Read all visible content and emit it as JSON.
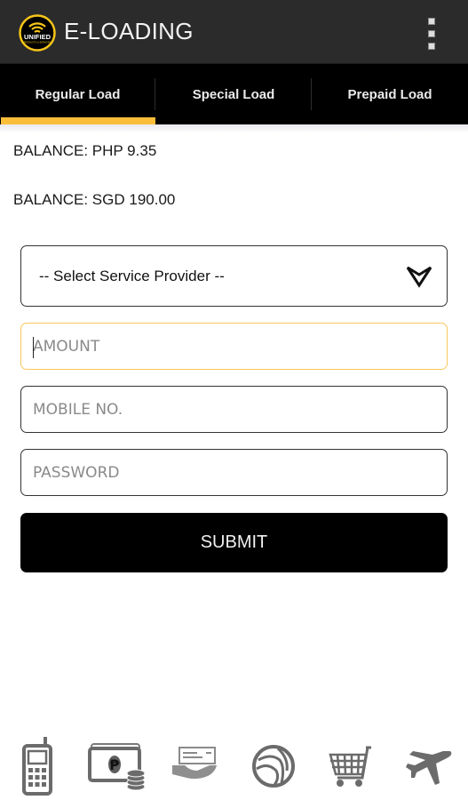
{
  "appbar": {
    "title": "E-LOADING",
    "logo": {
      "name": "unified-logo",
      "text": "UNIFIED",
      "subtext": "PRODUCTS & SERVICES",
      "accent": "#f5c518"
    },
    "menu_icon": "overflow-menu-icon"
  },
  "tabs": [
    {
      "label": "Regular Load",
      "selected": true
    },
    {
      "label": "Special Load",
      "selected": false
    },
    {
      "label": "Prepaid Load",
      "selected": false
    }
  ],
  "balances": [
    "BALANCE: PHP 9.35",
    "BALANCE: SGD 190.00"
  ],
  "form": {
    "service_provider": {
      "selected": "-- Select Service Provider --",
      "icon": "chevron-down-icon"
    },
    "amount": {
      "value": "",
      "placeholder": "AMOUNT",
      "focused": true
    },
    "mobile": {
      "value": "",
      "placeholder": "MOBILE NO."
    },
    "password": {
      "value": "",
      "placeholder": "PASSWORD"
    },
    "submit_label": "SUBMIT"
  },
  "bottom_nav": [
    {
      "name": "mobile-phone-icon"
    },
    {
      "name": "cash-peso-icon"
    },
    {
      "name": "bill-payment-icon"
    },
    {
      "name": "globe-icon"
    },
    {
      "name": "shopping-cart-icon"
    },
    {
      "name": "airplane-icon"
    }
  ],
  "colors": {
    "appbar_bg": "#2b2b2b",
    "tabbar_bg": "#000000",
    "accent": "#fbbd3a",
    "icon_gray": "#6b6b6b"
  }
}
